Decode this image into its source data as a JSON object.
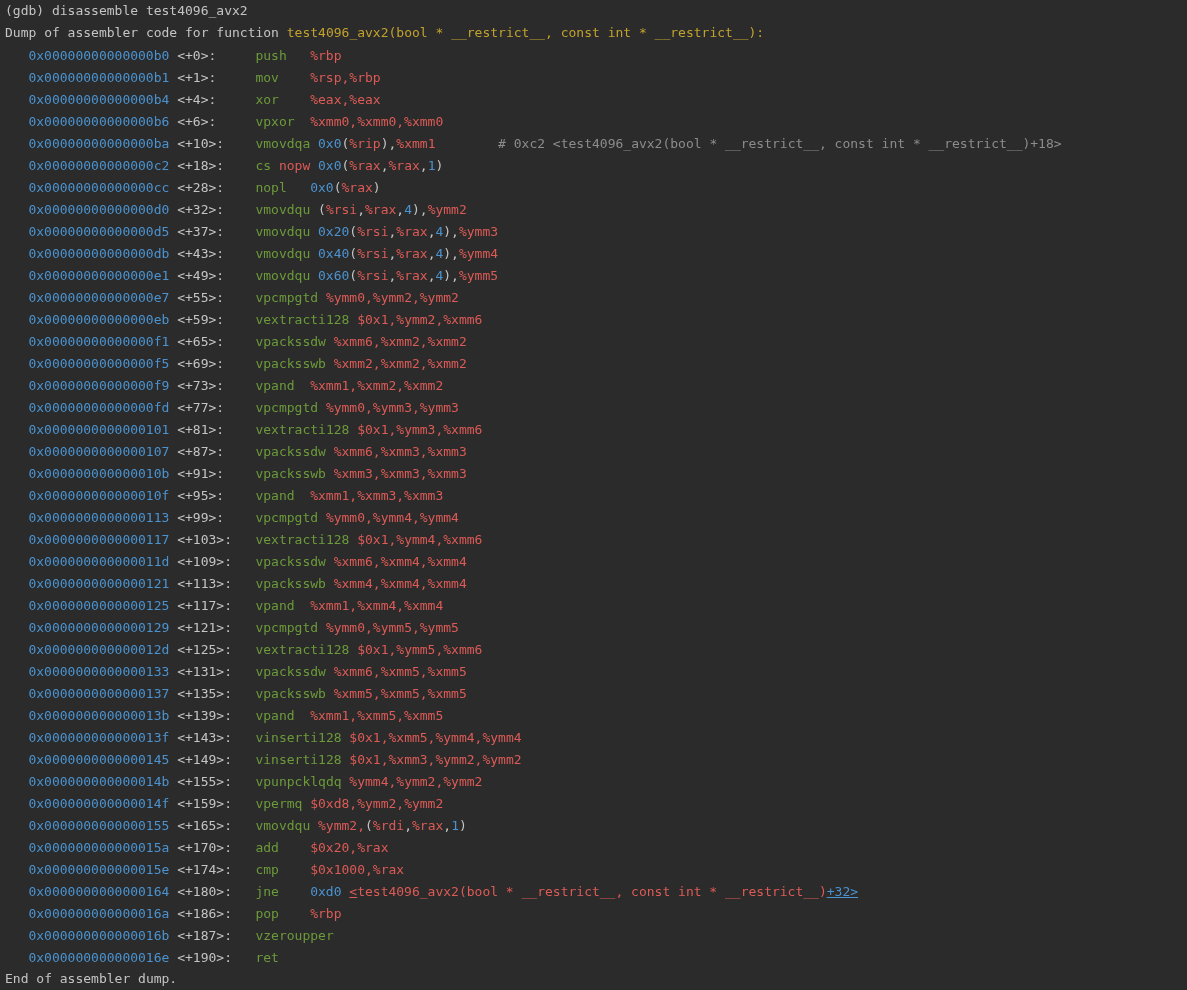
{
  "command": "(gdb) disassemble test4096_avx2",
  "header": {
    "text": "Dump of assembler code for function ",
    "function": "test4096_avx2(bool * __restrict__, const int * __restrict__):"
  },
  "lines": [
    {
      "address": "0x00000000000000b0",
      "offset": "<+0>:",
      "mnemonic": "push",
      "operands": [
        {
          "kind": "reg",
          "text": "%rbp"
        }
      ]
    },
    {
      "address": "0x00000000000000b1",
      "offset": "<+1>:",
      "mnemonic": "mov",
      "operands": [
        {
          "kind": "reg",
          "text": "%rsp,%rbp"
        }
      ]
    },
    {
      "address": "0x00000000000000b4",
      "offset": "<+4>:",
      "mnemonic": "xor",
      "operands": [
        {
          "kind": "reg",
          "text": "%eax,%eax"
        }
      ]
    },
    {
      "address": "0x00000000000000b6",
      "offset": "<+6>:",
      "mnemonic": "vpxor",
      "operands": [
        {
          "kind": "reg",
          "text": "%xmm0,%xmm0,%xmm0"
        }
      ]
    },
    {
      "address": "0x00000000000000ba",
      "offset": "<+10>:",
      "mnemonic": "vmovdqa",
      "operands": [
        {
          "kind": "num",
          "text": "0x0"
        },
        {
          "kind": "punct",
          "text": "("
        },
        {
          "kind": "reg",
          "text": "%rip"
        },
        {
          "kind": "punct",
          "text": "),"
        },
        {
          "kind": "reg",
          "text": "%xmm1"
        }
      ],
      "comment": "# 0xc2 <test4096_avx2(bool * __restrict__, const int * __restrict__)+18>"
    },
    {
      "address": "0x00000000000000c2",
      "offset": "<+18>:",
      "mnemonic": "cs",
      "operands": [
        {
          "kind": "op2",
          "text": "nopw"
        },
        {
          "kind": "num",
          "text": "0x0"
        },
        {
          "kind": "punct",
          "text": "("
        },
        {
          "kind": "reg",
          "text": "%rax"
        },
        {
          "kind": "punct",
          "text": ","
        },
        {
          "kind": "reg",
          "text": "%rax"
        },
        {
          "kind": "punct",
          "text": ","
        },
        {
          "kind": "num",
          "text": "1"
        },
        {
          "kind": "punct",
          "text": ")"
        }
      ]
    },
    {
      "address": "0x00000000000000cc",
      "offset": "<+28>:",
      "mnemonic": "nopl",
      "operands": [
        {
          "kind": "num",
          "text": "0x0"
        },
        {
          "kind": "punct",
          "text": "("
        },
        {
          "kind": "reg",
          "text": "%rax"
        },
        {
          "kind": "punct",
          "text": ")"
        }
      ]
    },
    {
      "address": "0x00000000000000d0",
      "offset": "<+32>:",
      "mnemonic": "vmovdqu",
      "operands": [
        {
          "kind": "punct",
          "text": "("
        },
        {
          "kind": "reg",
          "text": "%rsi"
        },
        {
          "kind": "punct",
          "text": ","
        },
        {
          "kind": "reg",
          "text": "%rax"
        },
        {
          "kind": "punct",
          "text": ","
        },
        {
          "kind": "num",
          "text": "4"
        },
        {
          "kind": "punct",
          "text": "),"
        },
        {
          "kind": "reg",
          "text": "%ymm2"
        }
      ]
    },
    {
      "address": "0x00000000000000d5",
      "offset": "<+37>:",
      "mnemonic": "vmovdqu",
      "operands": [
        {
          "kind": "num",
          "text": "0x20"
        },
        {
          "kind": "punct",
          "text": "("
        },
        {
          "kind": "reg",
          "text": "%rsi"
        },
        {
          "kind": "punct",
          "text": ","
        },
        {
          "kind": "reg",
          "text": "%rax"
        },
        {
          "kind": "punct",
          "text": ","
        },
        {
          "kind": "num",
          "text": "4"
        },
        {
          "kind": "punct",
          "text": "),"
        },
        {
          "kind": "reg",
          "text": "%ymm3"
        }
      ]
    },
    {
      "address": "0x00000000000000db",
      "offset": "<+43>:",
      "mnemonic": "vmovdqu",
      "operands": [
        {
          "kind": "num",
          "text": "0x40"
        },
        {
          "kind": "punct",
          "text": "("
        },
        {
          "kind": "reg",
          "text": "%rsi"
        },
        {
          "kind": "punct",
          "text": ","
        },
        {
          "kind": "reg",
          "text": "%rax"
        },
        {
          "kind": "punct",
          "text": ","
        },
        {
          "kind": "num",
          "text": "4"
        },
        {
          "kind": "punct",
          "text": "),"
        },
        {
          "kind": "reg",
          "text": "%ymm4"
        }
      ]
    },
    {
      "address": "0x00000000000000e1",
      "offset": "<+49>:",
      "mnemonic": "vmovdqu",
      "operands": [
        {
          "kind": "num",
          "text": "0x60"
        },
        {
          "kind": "punct",
          "text": "("
        },
        {
          "kind": "reg",
          "text": "%rsi"
        },
        {
          "kind": "punct",
          "text": ","
        },
        {
          "kind": "reg",
          "text": "%rax"
        },
        {
          "kind": "punct",
          "text": ","
        },
        {
          "kind": "num",
          "text": "4"
        },
        {
          "kind": "punct",
          "text": "),"
        },
        {
          "kind": "reg",
          "text": "%ymm5"
        }
      ]
    },
    {
      "address": "0x00000000000000e7",
      "offset": "<+55>:",
      "mnemonic": "vpcmpgtd",
      "operands": [
        {
          "kind": "reg",
          "text": "%ymm0,%ymm2,%ymm2"
        }
      ]
    },
    {
      "address": "0x00000000000000eb",
      "offset": "<+59>:",
      "mnemonic": "vextracti128",
      "operands": [
        {
          "kind": "reg",
          "text": "$0x1,%ymm2,%xmm6"
        }
      ]
    },
    {
      "address": "0x00000000000000f1",
      "offset": "<+65>:",
      "mnemonic": "vpackssdw",
      "operands": [
        {
          "kind": "reg",
          "text": "%xmm6,%xmm2,%xmm2"
        }
      ]
    },
    {
      "address": "0x00000000000000f5",
      "offset": "<+69>:",
      "mnemonic": "vpacksswb",
      "operands": [
        {
          "kind": "reg",
          "text": "%xmm2,%xmm2,%xmm2"
        }
      ]
    },
    {
      "address": "0x00000000000000f9",
      "offset": "<+73>:",
      "mnemonic": "vpand",
      "operands": [
        {
          "kind": "reg",
          "text": "%xmm1,%xmm2,%xmm2"
        }
      ]
    },
    {
      "address": "0x00000000000000fd",
      "offset": "<+77>:",
      "mnemonic": "vpcmpgtd",
      "operands": [
        {
          "kind": "reg",
          "text": "%ymm0,%ymm3,%ymm3"
        }
      ]
    },
    {
      "address": "0x0000000000000101",
      "offset": "<+81>:",
      "mnemonic": "vextracti128",
      "operands": [
        {
          "kind": "reg",
          "text": "$0x1,%ymm3,%xmm6"
        }
      ]
    },
    {
      "address": "0x0000000000000107",
      "offset": "<+87>:",
      "mnemonic": "vpackssdw",
      "operands": [
        {
          "kind": "reg",
          "text": "%xmm6,%xmm3,%xmm3"
        }
      ]
    },
    {
      "address": "0x000000000000010b",
      "offset": "<+91>:",
      "mnemonic": "vpacksswb",
      "operands": [
        {
          "kind": "reg",
          "text": "%xmm3,%xmm3,%xmm3"
        }
      ]
    },
    {
      "address": "0x000000000000010f",
      "offset": "<+95>:",
      "mnemonic": "vpand",
      "operands": [
        {
          "kind": "reg",
          "text": "%xmm1,%xmm3,%xmm3"
        }
      ]
    },
    {
      "address": "0x0000000000000113",
      "offset": "<+99>:",
      "mnemonic": "vpcmpgtd",
      "operands": [
        {
          "kind": "reg",
          "text": "%ymm0,%ymm4,%ymm4"
        }
      ]
    },
    {
      "address": "0x0000000000000117",
      "offset": "<+103>:",
      "mnemonic": "vextracti128",
      "operands": [
        {
          "kind": "reg",
          "text": "$0x1,%ymm4,%xmm6"
        }
      ]
    },
    {
      "address": "0x000000000000011d",
      "offset": "<+109>:",
      "mnemonic": "vpackssdw",
      "operands": [
        {
          "kind": "reg",
          "text": "%xmm6,%xmm4,%xmm4"
        }
      ]
    },
    {
      "address": "0x0000000000000121",
      "offset": "<+113>:",
      "mnemonic": "vpacksswb",
      "operands": [
        {
          "kind": "reg",
          "text": "%xmm4,%xmm4,%xmm4"
        }
      ]
    },
    {
      "address": "0x0000000000000125",
      "offset": "<+117>:",
      "mnemonic": "vpand",
      "operands": [
        {
          "kind": "reg",
          "text": "%xmm1,%xmm4,%xmm4"
        }
      ]
    },
    {
      "address": "0x0000000000000129",
      "offset": "<+121>:",
      "mnemonic": "vpcmpgtd",
      "operands": [
        {
          "kind": "reg",
          "text": "%ymm0,%ymm5,%ymm5"
        }
      ]
    },
    {
      "address": "0x000000000000012d",
      "offset": "<+125>:",
      "mnemonic": "vextracti128",
      "operands": [
        {
          "kind": "reg",
          "text": "$0x1,%ymm5,%xmm6"
        }
      ]
    },
    {
      "address": "0x0000000000000133",
      "offset": "<+131>:",
      "mnemonic": "vpackssdw",
      "operands": [
        {
          "kind": "reg",
          "text": "%xmm6,%xmm5,%xmm5"
        }
      ]
    },
    {
      "address": "0x0000000000000137",
      "offset": "<+135>:",
      "mnemonic": "vpacksswb",
      "operands": [
        {
          "kind": "reg",
          "text": "%xmm5,%xmm5,%xmm5"
        }
      ]
    },
    {
      "address": "0x000000000000013b",
      "offset": "<+139>:",
      "mnemonic": "vpand",
      "operands": [
        {
          "kind": "reg",
          "text": "%xmm1,%xmm5,%xmm5"
        }
      ]
    },
    {
      "address": "0x000000000000013f",
      "offset": "<+143>:",
      "mnemonic": "vinserti128",
      "operands": [
        {
          "kind": "reg",
          "text": "$0x1,%xmm5,%ymm4,%ymm4"
        }
      ]
    },
    {
      "address": "0x0000000000000145",
      "offset": "<+149>:",
      "mnemonic": "vinserti128",
      "operands": [
        {
          "kind": "reg",
          "text": "$0x1,%xmm3,%ymm2,%ymm2"
        }
      ]
    },
    {
      "address": "0x000000000000014b",
      "offset": "<+155>:",
      "mnemonic": "vpunpcklqdq",
      "operands": [
        {
          "kind": "reg",
          "text": "%ymm4,%ymm2,%ymm2"
        }
      ]
    },
    {
      "address": "0x000000000000014f",
      "offset": "<+159>:",
      "mnemonic": "vpermq",
      "operands": [
        {
          "kind": "reg",
          "text": "$0xd8,%ymm2,%ymm2"
        }
      ]
    },
    {
      "address": "0x0000000000000155",
      "offset": "<+165>:",
      "mnemonic": "vmovdqu",
      "operands": [
        {
          "kind": "reg",
          "text": "%ymm2,"
        },
        {
          "kind": "punct",
          "text": "("
        },
        {
          "kind": "reg",
          "text": "%rdi"
        },
        {
          "kind": "punct",
          "text": ","
        },
        {
          "kind": "reg",
          "text": "%rax"
        },
        {
          "kind": "punct",
          "text": ","
        },
        {
          "kind": "num",
          "text": "1"
        },
        {
          "kind": "punct",
          "text": ")"
        }
      ]
    },
    {
      "address": "0x000000000000015a",
      "offset": "<+170>:",
      "mnemonic": "add",
      "operands": [
        {
          "kind": "reg",
          "text": "$0x20,%rax"
        }
      ]
    },
    {
      "address": "0x000000000000015e",
      "offset": "<+174>:",
      "mnemonic": "cmp",
      "operands": [
        {
          "kind": "reg",
          "text": "$0x1000,%rax"
        }
      ]
    },
    {
      "address": "0x0000000000000164",
      "offset": "<+180>:",
      "mnemonic": "jne",
      "operands": [
        {
          "kind": "num",
          "text": "0xd0"
        },
        {
          "kind": "link-start",
          "text": "<"
        },
        {
          "kind": "sym",
          "text": "test4096_avx2(bool * __restrict__, const int * __restrict__)"
        },
        {
          "kind": "link-end",
          "text": "+32>"
        }
      ]
    },
    {
      "address": "0x000000000000016a",
      "offset": "<+186>:",
      "mnemonic": "pop",
      "operands": [
        {
          "kind": "reg",
          "text": "%rbp"
        }
      ]
    },
    {
      "address": "0x000000000000016b",
      "offset": "<+187>:",
      "mnemonic": "vzeroupper"
    },
    {
      "address": "0x000000000000016e",
      "offset": "<+190>:",
      "mnemonic": "ret"
    }
  ],
  "footer": "End of assembler dump."
}
